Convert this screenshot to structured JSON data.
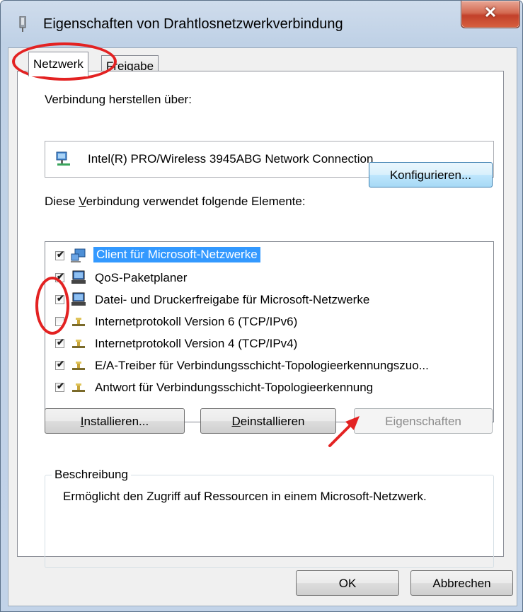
{
  "window": {
    "title": "Eigenschaften von Drahtlosnetzwerkverbindung",
    "close_glyph": "✕"
  },
  "tabs": [
    {
      "label": "Netzwerk"
    },
    {
      "label": "Freigabe"
    }
  ],
  "connect_label": "Verbindung herstellen über:",
  "adapter": {
    "name": "Intel(R) PRO/Wireless 3945ABG Network Connection"
  },
  "buttons": {
    "configure": "Konfigurieren...",
    "install_key": "I",
    "install_rest": "nstallieren...",
    "uninstall_key": "D",
    "uninstall_rest": "einstallieren",
    "properties": "Eigenschaften",
    "ok": "OK",
    "cancel": "Abbrechen"
  },
  "items_label": {
    "before": "Diese ",
    "key": "V",
    "after": "erbindung verwendet folgende Elemente:"
  },
  "items": [
    {
      "label": "Client für Microsoft-Netzwerke",
      "checked": true,
      "mark": "✔"
    },
    {
      "label": "QoS-Paketplaner",
      "checked": true,
      "mark": "✔"
    },
    {
      "label": "Datei- und Druckerfreigabe für Microsoft-Netzwerke",
      "checked": true,
      "mark": "✔"
    },
    {
      "label": "Internetprotokoll Version 6 (TCP/IPv6)",
      "checked": false,
      "mark": ""
    },
    {
      "label": "Internetprotokoll Version 4 (TCP/IPv4)",
      "checked": true,
      "mark": "✔"
    },
    {
      "label": "E/A-Treiber für Verbindungsschicht-Topologieerkennungszuo...",
      "checked": true,
      "mark": "✔"
    },
    {
      "label": "Antwort für Verbindungsschicht-Topologieerkennung",
      "checked": true,
      "mark": "✔"
    }
  ],
  "description": {
    "title": "Beschreibung",
    "text": "Ermöglicht den Zugriff auf Ressourcen in einem Microsoft-Netzwerk."
  },
  "colors": {
    "selection": "#3399ff",
    "annotation": "#e32222",
    "close_button": "#c2402a"
  }
}
